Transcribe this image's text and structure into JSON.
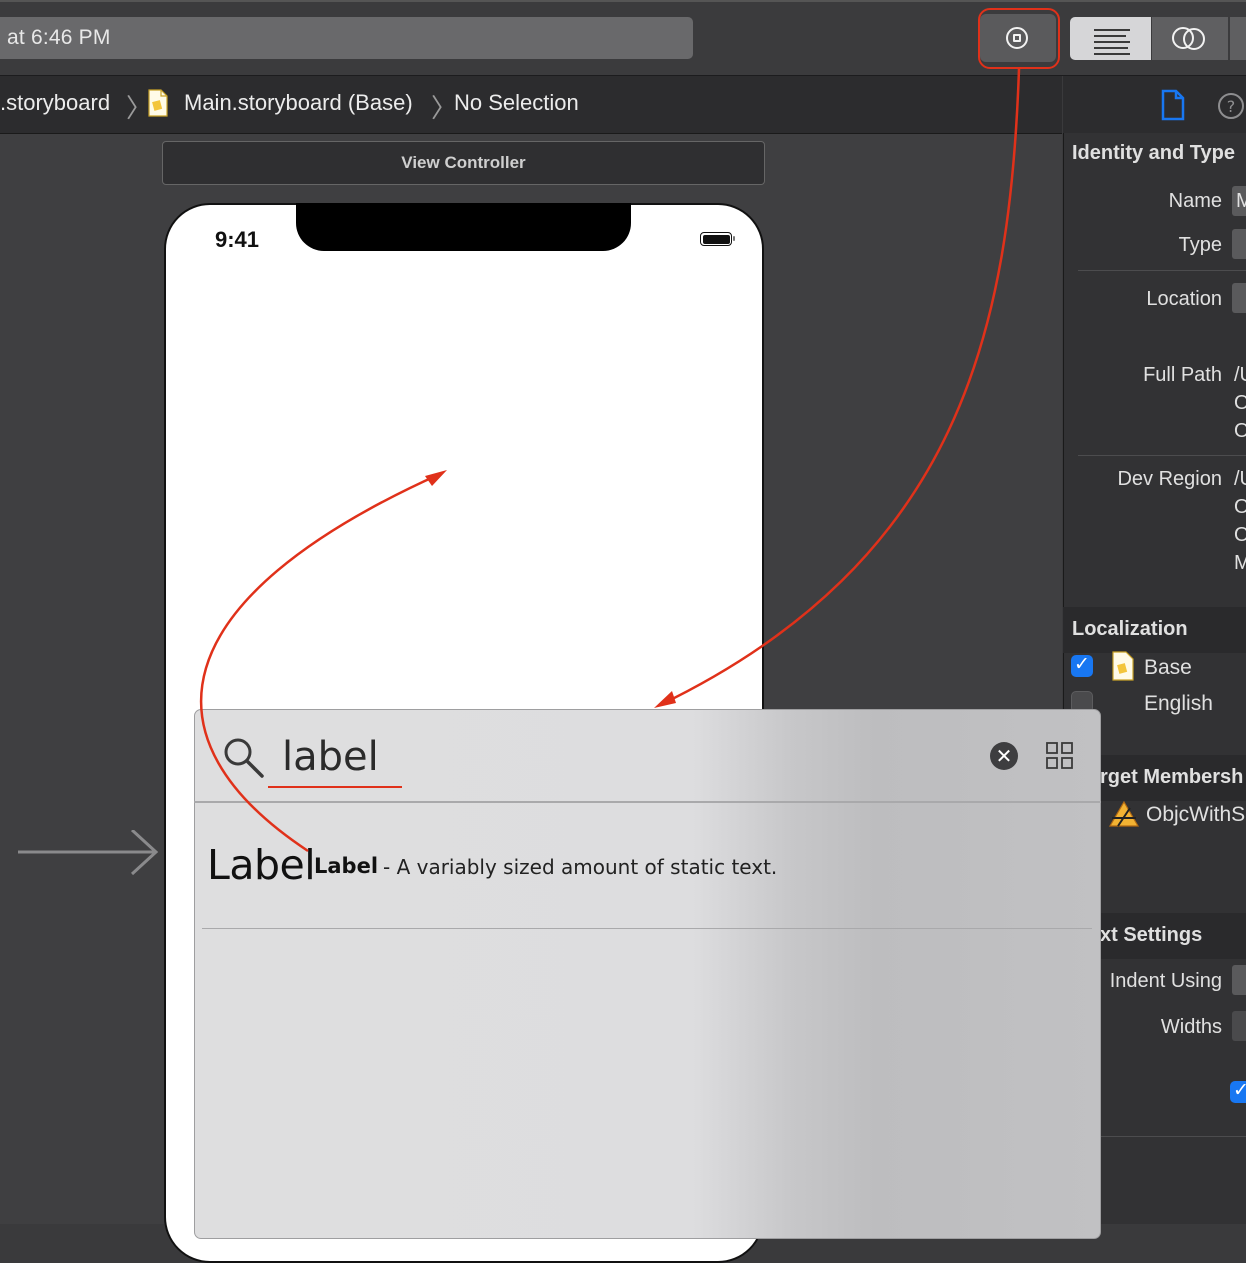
{
  "toolbar": {
    "activity_text": "at 6:46 PM",
    "library_button_icon": "library-icon",
    "editor_standard_icon": "standard-editor-icon",
    "editor_assistant_icon": "assistant-editor-icon",
    "highlight_color": "#e0311a"
  },
  "jumpbar": {
    "crumbs": [
      ".storyboard",
      "Main.storyboard (Base)",
      "No Selection"
    ]
  },
  "canvas": {
    "scene_title": "View Controller",
    "status_time": "9:41"
  },
  "library": {
    "search_value": "label",
    "results": [
      {
        "preview": "Label",
        "name": "Label",
        "description": " - A variably sized amount of static text."
      }
    ]
  },
  "inspector": {
    "identity_title": "Identity and Type",
    "name_label": "Name",
    "name_value": "M",
    "type_label": "Type",
    "location_label": "Location",
    "full_path_label": "Full Path",
    "full_path_value_lines": [
      "/U",
      "O",
      "O"
    ],
    "dev_region_label": "Dev Region",
    "dev_region_value_lines": [
      "/U",
      "O",
      "O",
      "M"
    ],
    "localization_title": "Localization",
    "localizations": [
      {
        "label": "Base",
        "checked": true
      },
      {
        "label": "English",
        "checked": false
      }
    ],
    "target_membership_title": "rget Membersh",
    "target_item": "ObjcWithS",
    "text_settings_title": "xt Settings",
    "indent_using_label": "Indent Using",
    "widths_label": "Widths",
    "accent_color": "#1877f2"
  }
}
